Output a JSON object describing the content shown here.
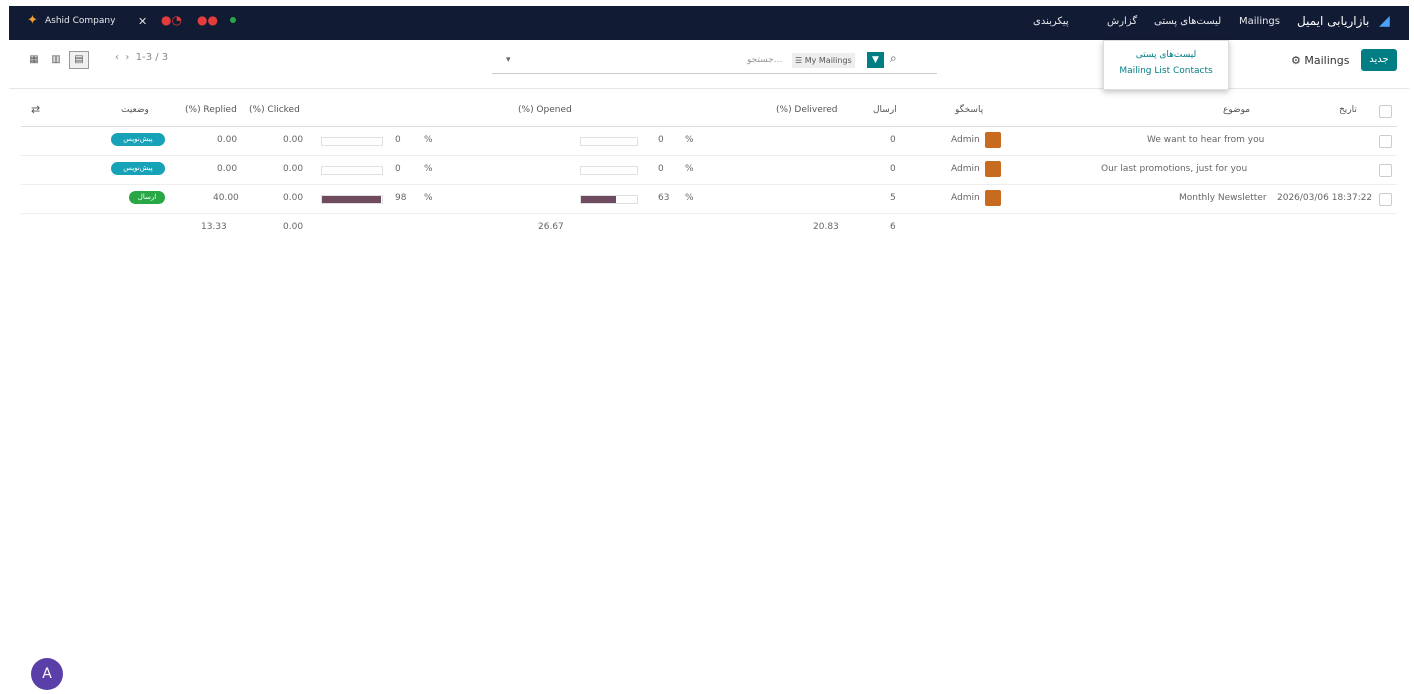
{
  "navbar": {
    "app_title": "بازاریابی ایمیل",
    "menu": [
      "Mailings",
      "لیست‌های پستی",
      "گزارش",
      "پیکربندی"
    ],
    "company": "Ashid Company"
  },
  "dropdown": {
    "items": [
      "لیست‌های پستی",
      "Mailing List Contacts"
    ]
  },
  "control": {
    "new_label": "جدید",
    "breadcrumb": "Mailings",
    "search_placeholder": "جستجو...",
    "facet_label": "My Mailings",
    "pager": "1-3 / 3"
  },
  "table": {
    "headers": {
      "date": "تاریخ",
      "subject": "موضوع",
      "responsible": "پاسخگو",
      "sent": "ارسال",
      "delivered": "(%) Delivered",
      "opened": "(%) Opened",
      "clicked": "(%) Clicked",
      "replied": "(%) Replied",
      "status": "وضعیت"
    },
    "rows": [
      {
        "date": "",
        "subject": "We want to hear from you",
        "responsible": "Admin",
        "sent": "0",
        "opened": "0",
        "opened_pct": 0,
        "clicked": "0.00",
        "clicked_pct_label": "0",
        "clicked_pct": 0,
        "replied": "0.00",
        "status": "پیش‌نویس",
        "status_color": "#17a2b8"
      },
      {
        "date": "",
        "subject": "Our last promotions, just for you",
        "responsible": "Admin",
        "sent": "0",
        "opened": "0",
        "opened_pct": 0,
        "clicked": "0.00",
        "clicked_pct_label": "0",
        "clicked_pct": 0,
        "replied": "0.00",
        "status": "پیش‌نویس",
        "status_color": "#17a2b8"
      },
      {
        "date": "2026/03/06 18:37:22",
        "subject": "Monthly Newsletter",
        "responsible": "Admin",
        "sent": "5",
        "opened": "63",
        "opened_pct": 63,
        "clicked": "0.00",
        "clicked_pct_label": "98",
        "clicked_pct": 98,
        "replied": "40.00",
        "status": "ارسال",
        "status_color": "#28a745"
      }
    ],
    "footer": {
      "sent": "6",
      "delivered": "20.83",
      "opened": "26.67",
      "clicked": "0.00",
      "replied": "13.33"
    },
    "pct_symbol": "%"
  },
  "user_initial": "A"
}
